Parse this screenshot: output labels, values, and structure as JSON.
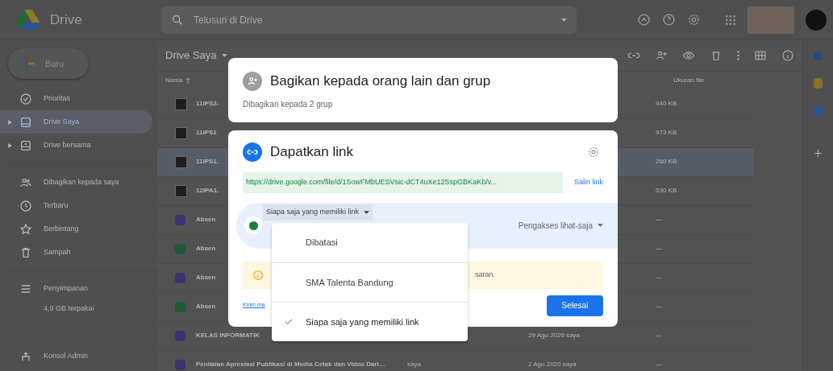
{
  "topbar": {
    "app_name": "Drive",
    "search": {
      "placeholder": "Telusuri di Drive"
    }
  },
  "sidebar": {
    "new_button": "Baru",
    "items": [
      {
        "label": "Prioritas",
        "kind": "priority",
        "selected": false,
        "expandable": false
      },
      {
        "label": "Drive Saya",
        "kind": "drive",
        "selected": true,
        "expandable": true
      },
      {
        "label": "Drive bersama",
        "kind": "shared_drive",
        "selected": false,
        "expandable": true
      },
      {
        "label": "Dibagikan kepada saya",
        "kind": "people",
        "selected": false,
        "expandable": false
      },
      {
        "label": "Terbaru",
        "kind": "clock",
        "selected": false,
        "expandable": false
      },
      {
        "label": "Berbintang",
        "kind": "star",
        "selected": false,
        "expandable": false
      },
      {
        "label": "Sampah",
        "kind": "trash",
        "selected": false,
        "expandable": false
      }
    ],
    "storage": {
      "label": "Penyimpanan",
      "usage": "4,9 GB terpakai"
    },
    "admin": "Konsol Admin"
  },
  "main": {
    "title": "Drive Saya",
    "columns": {
      "name": "Nama",
      "size": "Ukuran file"
    },
    "rows": [
      {
        "kind": "image",
        "name": "11IPS2-",
        "size": "940 KB",
        "selected": false
      },
      {
        "kind": "image",
        "name": "11IPS1",
        "size": "973 KB",
        "selected": false
      },
      {
        "kind": "image",
        "name": "11IPS1.",
        "size": "260 KB",
        "selected": true
      },
      {
        "kind": "image",
        "name": "12IPA1.",
        "size": "530 KB",
        "selected": false
      },
      {
        "kind": "form",
        "name": "Absen",
        "size": "—",
        "selected": false
      },
      {
        "kind": "sheet",
        "name": "Absen",
        "size": "—",
        "selected": false
      },
      {
        "kind": "form",
        "name": "Absen",
        "size": "—",
        "selected": false
      },
      {
        "kind": "sheet",
        "name": "Absen",
        "size": "—",
        "selected": false
      },
      {
        "kind": "form",
        "name": "KELAS INFORMATIK",
        "modified": "29 Agu 2020 saya",
        "size": "—",
        "selected": false
      },
      {
        "kind": "form",
        "name": "Penilaian Apresiasi Publikasi di Media Cetak dan Video Dari…",
        "owner": "saya",
        "modified": "2 Agu 2020 saya",
        "size": "—",
        "selected": false
      }
    ]
  },
  "share_panel": {
    "title": "Bagikan kepada orang lain dan grup",
    "subtitle": "Dibagikan kepada 2 grup"
  },
  "link_panel": {
    "title": "Dapatkan link",
    "url": "https://drive.google.com/file/d/1SowFMbUESVsic-dCT4uXe12SspGBKaKb/v...",
    "copy_label": "Salin link",
    "access_scope": "Siapa saja yang memiliki link",
    "access_role": "Pengakses lihat-saja",
    "notice": "saran.",
    "link_text": "Kirim ma",
    "done_button": "Selesai"
  },
  "access_menu": {
    "options": [
      {
        "label": "Dibatasi",
        "selected": false
      },
      {
        "label": "SMA Talenta Bandung",
        "selected": false
      },
      {
        "label": "Siapa saja yang memiliki link",
        "selected": true
      }
    ]
  }
}
